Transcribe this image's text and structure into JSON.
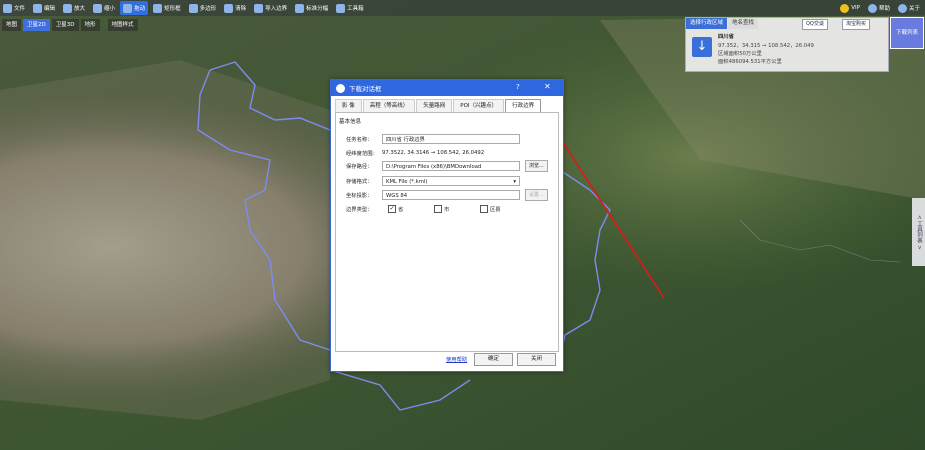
{
  "toolbar": {
    "items": [
      "文件",
      "编辑",
      "放大",
      "缩小",
      "拖动",
      "矩形框",
      "多边形",
      "清除",
      "导入边界",
      "标准分幅",
      "工具箱"
    ],
    "active": "拖动",
    "right_items": [
      "VIP",
      "帮助",
      "关于"
    ]
  },
  "map_types": {
    "items": [
      "地图",
      "卫星2D",
      "卫星3D",
      "地形",
      "地图样式"
    ],
    "active": "卫星2D"
  },
  "right_panel": {
    "tab_region": "选择行政区域",
    "tab_name_search": "地名查找",
    "qq_btn": "QQ交谈",
    "taobao_btn": "淘宝购买",
    "region_name": "四川省",
    "coords": "97.352，34.315 → 108.542，26.049",
    "area1": "区域面积50万公里",
    "area2": "面积486094.531平方公里"
  },
  "download_list": "下载列表",
  "side_tab": "< 工具列表 >",
  "dialog": {
    "title": "下载对话框",
    "help": "?",
    "close": "✕",
    "tabs": [
      "影 像",
      "高程（等高线）",
      "矢量路网",
      "POI（兴趣点）",
      "行政边界"
    ],
    "active_tab": "行政边界",
    "section": "基本信息",
    "task_name_label": "任务名称：",
    "task_name_value": "四川省 行政边界",
    "range_label": "经纬度范围：",
    "range_value": "97.3522, 34.3146  →  108.542, 26.0492",
    "save_label": "保存路径：",
    "save_value": "D:\\Program Files (x86)\\BMDownload",
    "browse_btn": "浏览...",
    "format_label": "存储格式：",
    "format_value": "KML File (*.kml)",
    "coord_label": "坐标投影：",
    "coord_value": "WGS 84",
    "setting_btn": "设置...",
    "level_label": "边界类型：",
    "level_province": "省",
    "level_city": "市",
    "level_county": "区县",
    "link": "使用帮助",
    "ok": "确定",
    "cancel": "关闭"
  }
}
